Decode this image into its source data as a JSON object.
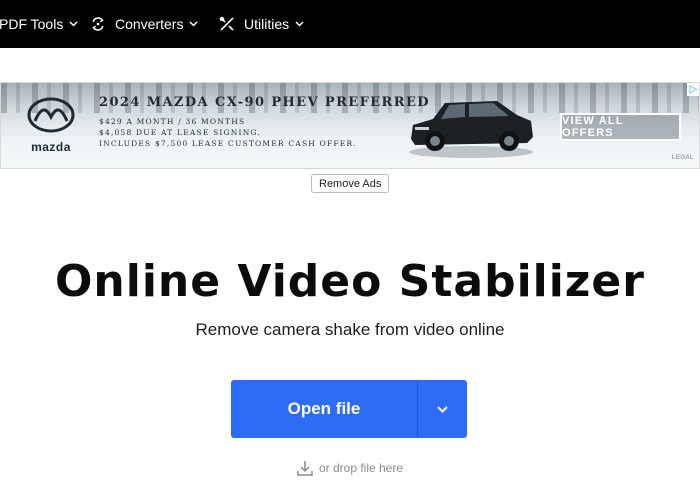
{
  "nav": {
    "items": [
      {
        "label": "PDF Tools",
        "icon": "chevron-down-icon"
      },
      {
        "label": "Converters",
        "icon": "convert-icon"
      },
      {
        "label": "Utilities",
        "icon": "tools-icon"
      }
    ]
  },
  "ad": {
    "brand": "mazda",
    "headline": "2024 MAZDA CX-90 PHEV PREFERRED",
    "line1": "$429 A MONTH / 36 MONTHS",
    "line2": "$4,058 DUE AT LEASE SIGNING.",
    "line3": "INCLUDES $7,500 LEASE CUSTOMER CASH OFFER.",
    "cta": "VIEW ALL OFFERS",
    "legal": "LEGAL"
  },
  "remove_ads_label": "Remove Ads",
  "page": {
    "title": "Online Video Stabilizer",
    "subtitle": "Remove camera shake from video online"
  },
  "open": {
    "label": "Open file",
    "drop_hint": "or drop file here"
  },
  "colors": {
    "nav_bg": "#000000",
    "primary": "#2e6cf5"
  }
}
